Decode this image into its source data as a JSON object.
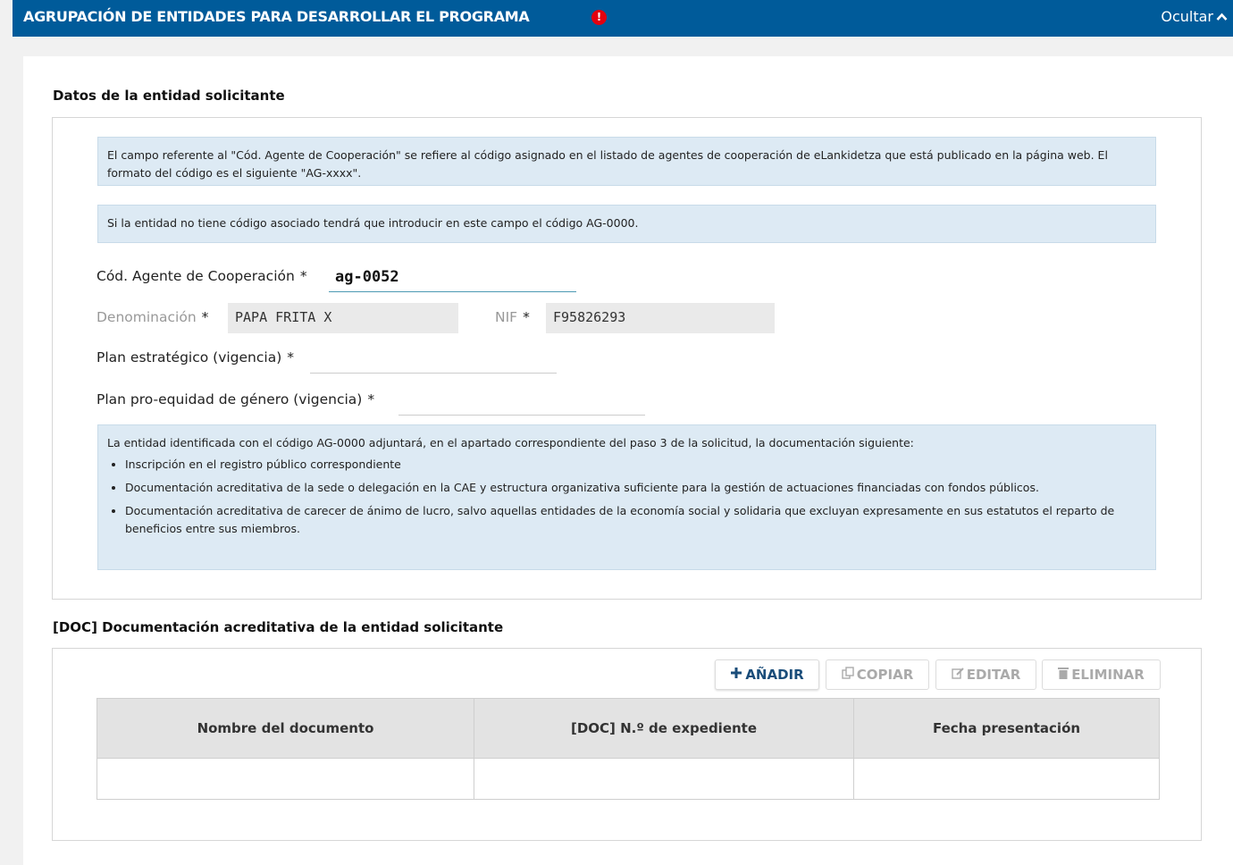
{
  "header": {
    "title": "AGRUPACIÓN DE ENTIDADES PARA DESARROLLAR EL PROGRAMA",
    "alert_symbol": "!",
    "toggle_label": "Ocultar",
    "toggle_icon": "chevron-up-icon"
  },
  "section1": {
    "title": "Datos de la entidad solicitante",
    "info1": "El campo referente al \"Cód. Agente de Cooperación\" se refiere al código asignado en el listado de agentes de cooperación de eLankidetza que está publicado en la página web. El formato del código es el siguiente \"AG-xxxx\".",
    "info2": "Si la entidad no tiene código asociado tendrá que introducir en este campo el código AG-0000.",
    "fields": {
      "agent_code_label": "Cód. Agente de Cooperación",
      "agent_code_value": "ag-0052",
      "denominacion_label": "Denominación",
      "denominacion_value": "PAPA FRITA X",
      "nif_label": "NIF",
      "nif_value": "F95826293",
      "plan_estrategico_label": "Plan estratégico (vigencia)",
      "plan_estrategico_value": "",
      "plan_genero_label": "Plan pro-equidad de género (vigencia)",
      "plan_genero_value": "",
      "required_mark": "*"
    },
    "info3": {
      "intro": "La entidad identificada con el código AG-0000 adjuntará, en el apartado correspondiente del paso 3 de la solicitud, la documentación siguiente:",
      "items": [
        "Inscripción en el registro público correspondiente",
        "Documentación acreditativa de la sede o delegación en la CAE y estructura organizativa suficiente para la gestión de actuaciones financiadas con fondos públicos.",
        "Documentación acreditativa de carecer de ánimo de lucro, salvo aquellas entidades de la economía social y solidaria que excluyan expresamente en sus estatutos el reparto de beneficios entre sus miembros."
      ]
    }
  },
  "section2": {
    "title": "[DOC] Documentación acreditativa de la entidad solicitante",
    "buttons": {
      "add": "AÑADIR",
      "copy": "COPIAR",
      "edit": "EDITAR",
      "delete": "ELIMINAR"
    },
    "table": {
      "columns": [
        "Nombre del documento",
        "[DOC] N.º de expediente",
        "Fecha presentación"
      ],
      "rows": [
        [
          "",
          "",
          ""
        ]
      ]
    }
  }
}
